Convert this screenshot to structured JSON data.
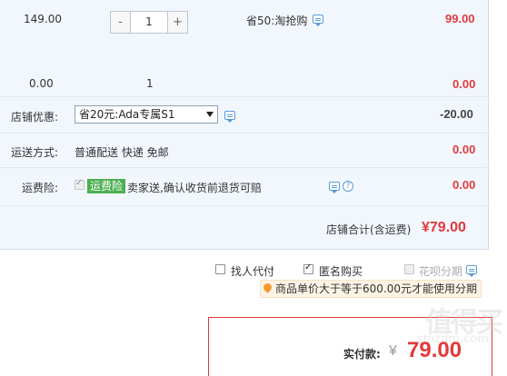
{
  "item_row": {
    "unit_price": "149.00",
    "quantity": "1",
    "minus": "-",
    "plus": "+",
    "discount_label": "省50:淘抢购",
    "subtotal": "99.00"
  },
  "item_row_2": {
    "unit_price": "0.00",
    "quantity": "1",
    "subtotal": "0.00"
  },
  "shop_discount": {
    "label": "店铺优惠:",
    "selected": "省20元:Ada专属S1",
    "amount": "-20.00"
  },
  "shipping": {
    "label": "运送方式:",
    "method": "普通配送 快递 免邮",
    "amount": "0.00"
  },
  "insurance": {
    "label": "运费险:",
    "tag": "运费险",
    "text": "卖家送,确认收货前退货可赔",
    "amount": "0.00"
  },
  "shop_total": {
    "label": "店铺合计(含运费)",
    "amount": "¥79.00"
  },
  "options": {
    "proxy_pay": "找人代付",
    "anonymous": "匿名购买",
    "installment": "花呗分期",
    "hint": "商品单价大于等于600.00元才能使用分期"
  },
  "payment": {
    "label": "实付款:",
    "currency": "¥",
    "amount": "79.00"
  },
  "watermark": {
    "main": "值得买",
    "sub": "smzdm.com"
  }
}
